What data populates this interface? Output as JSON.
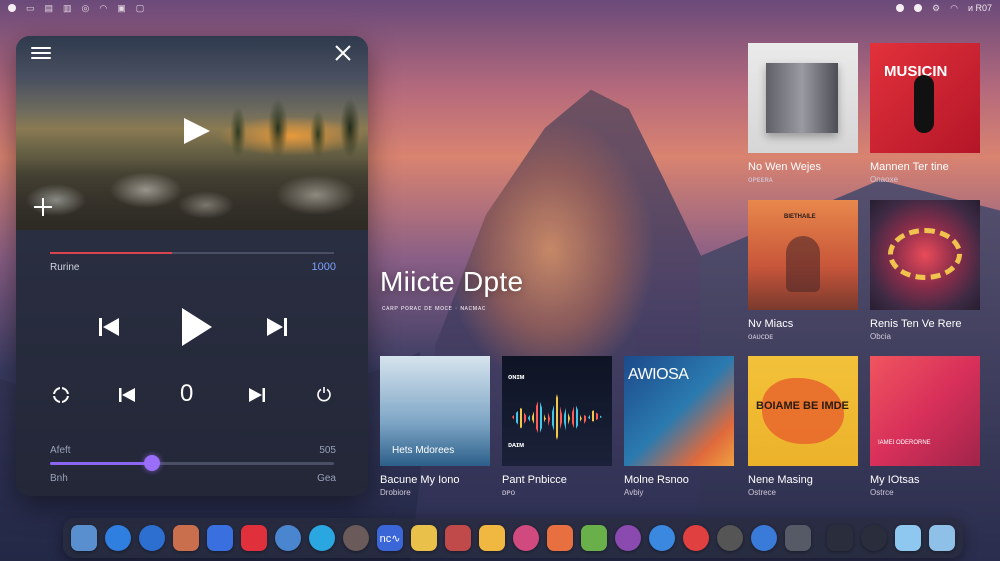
{
  "menubar": {
    "right_text": "ᴎ R07"
  },
  "player": {
    "track_label": "Rurine",
    "track_value": "1000",
    "progress": 0.43,
    "zero_label": "0",
    "slider_label_left": "Afeft",
    "slider_label_right": "505",
    "slider_value": 0.36,
    "bottom_left": "Bnh",
    "bottom_right": "Gea"
  },
  "hero": {
    "title": "Miicte Dpte",
    "subtitle": "ᴄᴀʀᴘ ᴘᴏʀᴀᴄ ᴅᴇ ᴍᴏᴄᴇ · ɴᴀᴄᴍᴀᴄ"
  },
  "albums": [
    {
      "title": "No Wen Wejes",
      "subtitle": "ᴏᴘᴇᴇʀᴀ"
    },
    {
      "title": "Mannen Ter tine",
      "subtitle": "Onaoxe"
    },
    {
      "title": "Nv Miacs",
      "subtitle": "ᴏᴀᴜᴄᴅᴇ"
    },
    {
      "title": "Renis Ten Ve Rere",
      "subtitle": "Obcia"
    },
    {
      "title": "Bacune My Iono",
      "subtitle": "Drobiore"
    },
    {
      "title": "Pant Pnbicce",
      "subtitle": "ᴅᴘᴏ"
    },
    {
      "title": "Molne Rsnoo",
      "subtitle": "Avbiy"
    },
    {
      "title": "Nene Masing",
      "subtitle": "Ostrece"
    },
    {
      "title": "My IOtsas",
      "subtitle": "Ostrce"
    }
  ],
  "cover_text": {
    "c2": "MUSICIN",
    "c3": "BIETHAILE",
    "c5": "Hets Mdorees",
    "c6_top": "ᴏɴɪᴍ",
    "c6_bottom": "ᴅᴀɪᴍ",
    "c7": "AWIOSA",
    "c8": "BOIAME BE IMDE",
    "c9": "IAMEI ODERORNE"
  },
  "dock": {
    "items": [
      {
        "icon": "finder-icon",
        "color": "#5a8fcf"
      },
      {
        "icon": "safari-icon",
        "color": "#2f7fe0"
      },
      {
        "icon": "compass-icon",
        "color": "#2c6fd0"
      },
      {
        "icon": "photos-app-icon",
        "color": "#c96f4e"
      },
      {
        "icon": "stocks-icon",
        "color": "#3a6fe0"
      },
      {
        "icon": "music-icon",
        "color": "#e0303c"
      },
      {
        "icon": "globe-icon",
        "color": "#4a86d0"
      },
      {
        "icon": "xcode-icon",
        "color": "#2aa6e0"
      },
      {
        "icon": "camera-icon",
        "color": "#6a5a5a"
      },
      {
        "icon": "nordvpn-icon",
        "color": "#3b66d8",
        "text": "nc∿"
      },
      {
        "icon": "notes-icon",
        "color": "#e8c04a"
      },
      {
        "icon": "photo-booth-icon",
        "color": "#c04a4a"
      },
      {
        "icon": "stickies-icon",
        "color": "#f0b840"
      },
      {
        "icon": "petal-icon",
        "color": "#d04a80"
      },
      {
        "icon": "flower-icon",
        "color": "#e87040"
      },
      {
        "icon": "maps-icon",
        "color": "#6ab04a"
      },
      {
        "icon": "siri-icon",
        "color": "#8a4ab0"
      },
      {
        "icon": "testflight-icon",
        "color": "#3a88e0"
      },
      {
        "icon": "lifesaver-icon",
        "color": "#e04040"
      },
      {
        "icon": "piano-icon",
        "color": "#555"
      },
      {
        "icon": "xcode2-icon",
        "color": "#3a7ad8"
      },
      {
        "icon": "trash-doc-icon",
        "color": "#555a66"
      },
      {
        "icon": "downloads-icon",
        "color": "#2a2e3c"
      },
      {
        "icon": "circle-icon",
        "color": "#2a2e3c"
      },
      {
        "icon": "folder-icon",
        "color": "#8ec8f0"
      },
      {
        "icon": "document-icon",
        "color": "#8ec0e8"
      }
    ]
  }
}
